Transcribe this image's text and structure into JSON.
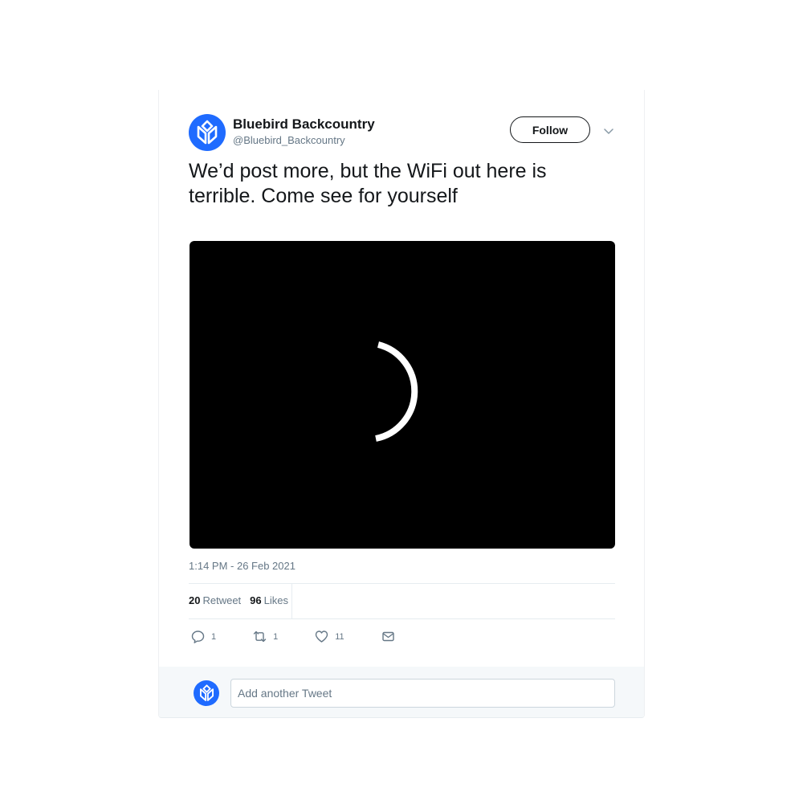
{
  "author": {
    "name": "Bluebird Backcountry",
    "handle": "@Bluebird_Backcountry",
    "avatar_icon": "wheat-leaf-logo-icon",
    "brand_color": "#1f6bff"
  },
  "header": {
    "follow_label": "Follow",
    "menu_icon": "chevron-down-icon"
  },
  "tweet": {
    "text": "We’d post more, but the WiFi out here is terrible. Come see for yourself",
    "media": {
      "state": "loading",
      "icon": "loading-spinner-icon"
    },
    "timestamp": "1:14 PM - 26 Feb 2021"
  },
  "stats": {
    "retweets_count": "20",
    "retweets_label": "Retweet",
    "likes_count": "96",
    "likes_label": "Likes"
  },
  "actions": [
    {
      "icon": "reply-icon",
      "count": "1"
    },
    {
      "icon": "retweet-icon",
      "count": "1"
    },
    {
      "icon": "heart-icon",
      "count": "11"
    },
    {
      "icon": "mail-icon",
      "count": ""
    }
  ],
  "reply": {
    "placeholder": "Add another Tweet"
  }
}
